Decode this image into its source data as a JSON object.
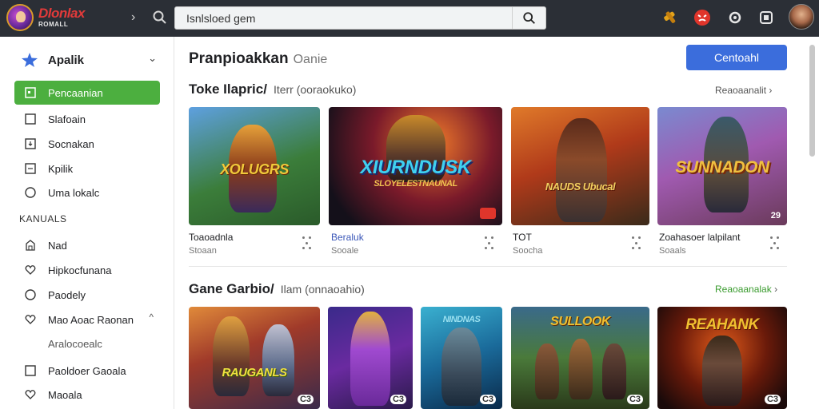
{
  "header": {
    "brand_title": "Dlonlax",
    "brand_subtitle": "ROMALL",
    "search_value": "Isnlsloed gem"
  },
  "sidebar": {
    "head_label": "Apalik",
    "items": [
      {
        "label": "Pencaanian",
        "icon": "square-dot-icon",
        "active": true
      },
      {
        "label": "Slafoain",
        "icon": "square-icon"
      },
      {
        "label": "Socnakan",
        "icon": "download-box-icon"
      },
      {
        "label": "Kpilik",
        "icon": "list-box-icon"
      },
      {
        "label": "Uma lokalc",
        "icon": "circle-icon"
      }
    ],
    "section_label": "KANUALS",
    "items2": [
      {
        "label": "Nad",
        "icon": "building-icon"
      },
      {
        "label": "Hipkocfunana",
        "icon": "heart-icon"
      },
      {
        "label": "Paodely",
        "icon": "circle-icon"
      },
      {
        "label": "Mao Aoac Raonan",
        "icon": "heart-icon",
        "tail": "^"
      }
    ],
    "sub_label": "Aralocoealc",
    "items3": [
      {
        "label": "Paoldoer Gaoala",
        "icon": "square-icon"
      },
      {
        "label": "Maoala",
        "icon": "heart-icon"
      }
    ]
  },
  "main": {
    "title": "Pranpioakkan",
    "title_sub": "Oanie",
    "primary_button": "Centoahl",
    "section1": {
      "title": "Toke Ilapric/",
      "meta": "Iterr   (ooraokuko)",
      "link": "Reaoaanalit",
      "cards": [
        {
          "art_title": "XOLUGRS",
          "name": "Toaoadnla",
          "sub": "Stoaan",
          "corner": ""
        },
        {
          "art_title": "XIURNDUSK",
          "art_sub": "SLOYELESTNAUNAL",
          "name": "Beraluk",
          "sub": "Sooale",
          "corner": "",
          "blue": true
        },
        {
          "art_title": "NAUDS Ubucal",
          "name": "TOT",
          "sub": "Soocha",
          "corner": ""
        },
        {
          "art_title": "SUNNADON",
          "name": "Zoahasoer lalpilant",
          "sub": "Soaals",
          "corner": "29"
        }
      ]
    },
    "section2": {
      "title": "Gane Garbio/",
      "meta": "Ilam   (onnaoahio)",
      "link": "Reaoaanalak",
      "cards": [
        {
          "art_title": "RAUGANLS",
          "corner": "C3"
        },
        {
          "art_title": "",
          "corner": "C3"
        },
        {
          "art_title": "NINDNAS",
          "corner": "C3"
        },
        {
          "art_title": "SULLOOK",
          "corner": "C3"
        },
        {
          "art_title": "REAHANK",
          "corner": "C3"
        }
      ]
    }
  },
  "colors": {
    "topbar": "#2b2f36",
    "sidebar_active": "#4caf3f",
    "primary_button": "#3b6ddc",
    "link_green": "#3a9b2e"
  }
}
